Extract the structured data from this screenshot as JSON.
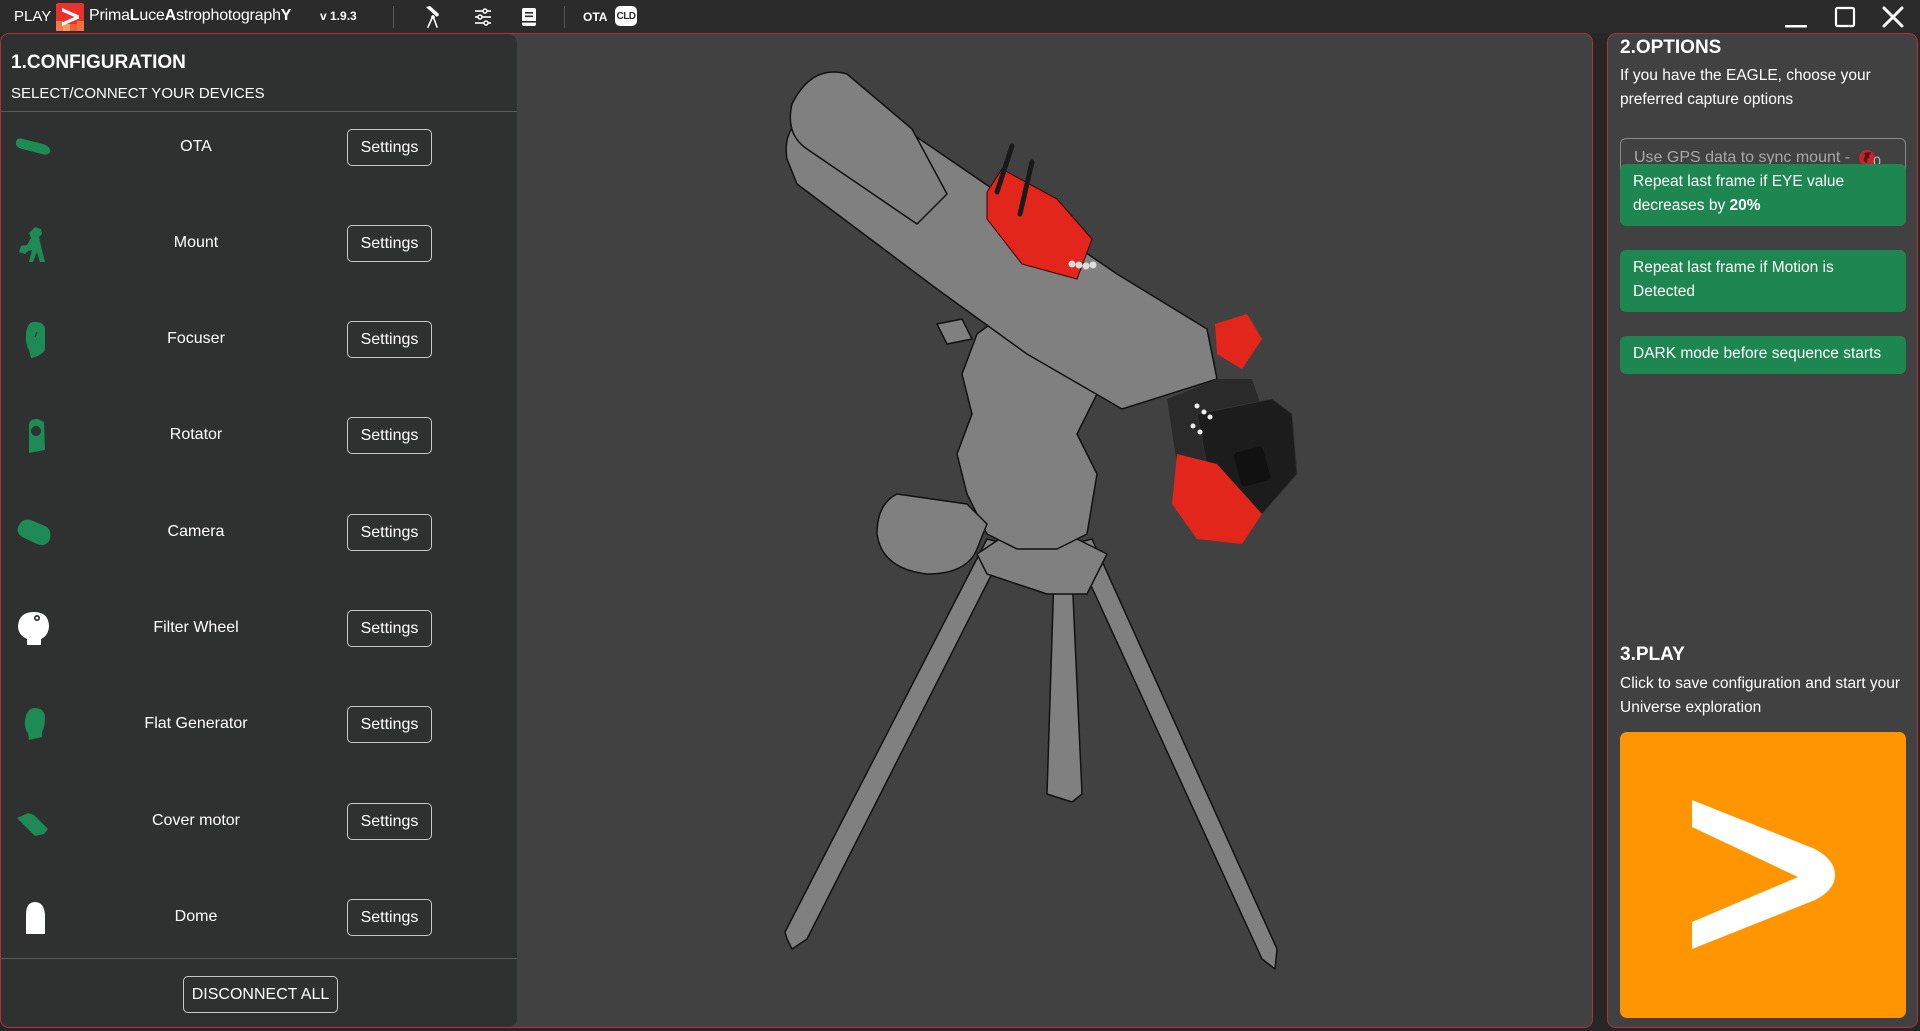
{
  "titlebar": {
    "play_label": "PLAY",
    "brand_light_1": "Prima",
    "brand_bold_1": "L",
    "brand_light_2": "uce",
    "brand_bold_2": "A",
    "brand_light_3": "strophotograph",
    "brand_bold_3": "Y",
    "version": "v 1.9.3",
    "icons": [
      "telescope-icon",
      "sliders-icon",
      "book-icon"
    ],
    "ota_label": "OTA",
    "cld_label": "CLD",
    "window_controls": [
      "minimize",
      "maximize",
      "close"
    ]
  },
  "configuration": {
    "title": "1.CONFIGURATION",
    "subtitle": "SELECT/CONNECT YOUR DEVICES",
    "devices": [
      {
        "label": "OTA",
        "icon": "ota-icon",
        "status_color": "#1e8a55",
        "button": "Settings"
      },
      {
        "label": "Mount",
        "icon": "mount-icon",
        "status_color": "#1e8a55",
        "button": "Settings"
      },
      {
        "label": "Focuser",
        "icon": "focuser-icon",
        "status_color": "#1e8a55",
        "button": "Settings"
      },
      {
        "label": "Rotator",
        "icon": "rotator-icon",
        "status_color": "#1e8a55",
        "button": "Settings"
      },
      {
        "label": "Camera",
        "icon": "camera-icon",
        "status_color": "#1e8a55",
        "button": "Settings"
      },
      {
        "label": "Filter Wheel",
        "icon": "filter-wheel-icon",
        "status_color": "#ffffff",
        "button": "Settings"
      },
      {
        "label": "Flat Generator",
        "icon": "flat-generator-icon",
        "status_color": "#1e8a55",
        "button": "Settings"
      },
      {
        "label": "Cover motor",
        "icon": "cover-motor-icon",
        "status_color": "#1e8a55",
        "button": "Settings"
      },
      {
        "label": "Dome",
        "icon": "dome-icon",
        "status_color": "#ffffff",
        "button": "Settings"
      }
    ],
    "disconnect_all": "DISCONNECT ALL"
  },
  "options": {
    "title": "2.OPTIONS",
    "description": "If you have the EAGLE, choose your preferred capture options",
    "gps_label": "Use GPS data to sync mount  -",
    "gps_count": "0",
    "toggles": [
      {
        "text": "Repeat last frame if EYE value decreases by ",
        "bold": "20%"
      },
      {
        "text": "Repeat last frame if Motion is Detected",
        "bold": ""
      },
      {
        "text": "DARK mode before sequence starts",
        "bold": ""
      }
    ]
  },
  "play": {
    "title": "3.PLAY",
    "description": "Click to save configuration and start your Universe exploration",
    "button_color": "#ff9500"
  },
  "colors": {
    "accent_red": "#b03040",
    "connected_green": "#1e8a55",
    "option_green": "#1e8650",
    "play_orange": "#ff9500"
  }
}
